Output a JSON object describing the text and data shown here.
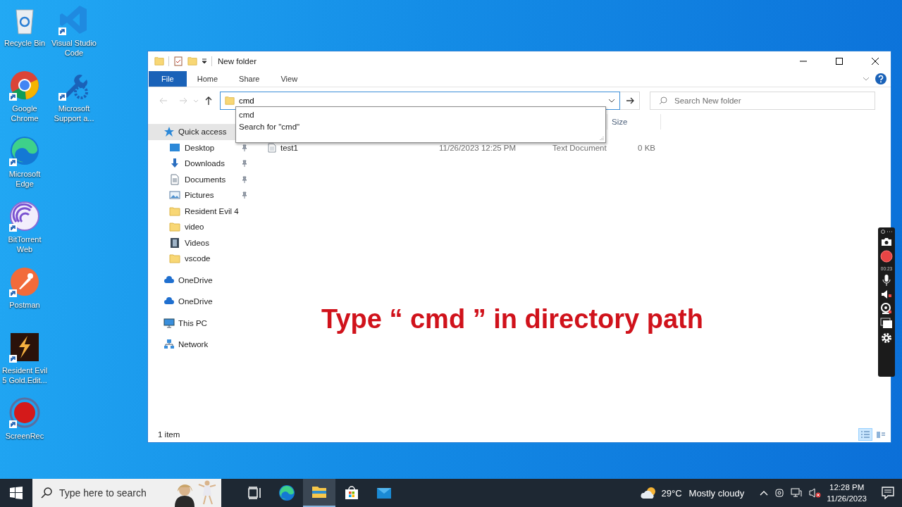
{
  "desktop_icon_columns": [
    [
      {
        "label": "Recycle Bin",
        "kind": "recycle",
        "shortcut": false
      },
      {
        "label": "Google Chrome",
        "kind": "chrome",
        "shortcut": true
      },
      {
        "label": "Microsoft Edge",
        "kind": "edge",
        "shortcut": true
      },
      {
        "label": "BitTorrent Web",
        "kind": "torrent",
        "shortcut": true
      },
      {
        "label": "Postman",
        "kind": "postman",
        "shortcut": true
      },
      {
        "label": "Resident Evil 5 Gold.Edit...",
        "kind": "game",
        "shortcut": true
      },
      {
        "label": "ScreenRec",
        "kind": "rec",
        "shortcut": true
      }
    ],
    [
      {
        "label": "Visual Studio Code",
        "kind": "vscode",
        "shortcut": true
      },
      {
        "label": "Microsoft Support a...",
        "kind": "support",
        "shortcut": true
      }
    ]
  ],
  "window": {
    "title": "New folder",
    "ribbon_tabs": [
      {
        "label": "File",
        "kind": "file"
      },
      {
        "label": "Home",
        "kind": "tab"
      },
      {
        "label": "Share",
        "kind": "tab"
      },
      {
        "label": "View",
        "kind": "tab"
      }
    ],
    "address": {
      "value": "cmd"
    },
    "suggestions": [
      "cmd",
      "Search for \"cmd\""
    ],
    "search": {
      "placeholder": "Search New folder"
    },
    "navigation": [
      {
        "label": "Quick access",
        "kind": "star",
        "selected": true,
        "children": [
          {
            "label": "Desktop",
            "kind": "desktop",
            "pinned": true
          },
          {
            "label": "Downloads",
            "kind": "download",
            "pinned": true
          },
          {
            "label": "Documents",
            "kind": "documents",
            "pinned": true
          },
          {
            "label": "Pictures",
            "kind": "pictures",
            "pinned": true
          },
          {
            "label": "Resident Evil 4",
            "kind": "folder",
            "pinned": false
          },
          {
            "label": "video",
            "kind": "folder",
            "pinned": false
          },
          {
            "label": "Videos",
            "kind": "videos",
            "pinned": false
          },
          {
            "label": "vscode",
            "kind": "folder",
            "pinned": false
          }
        ]
      },
      {
        "label": "OneDrive",
        "kind": "cloud",
        "selected": false
      },
      {
        "label": "OneDrive",
        "kind": "cloud",
        "selected": false
      },
      {
        "label": "This PC",
        "kind": "pc",
        "selected": false
      },
      {
        "label": "Network",
        "kind": "network",
        "selected": false
      }
    ],
    "column_headers": [
      "Size"
    ],
    "files": [
      {
        "name": "test1",
        "date_modified": "11/26/2023 12:25 PM",
        "type": "Text Document",
        "size": "0 KB"
      }
    ],
    "status_bar": "1 item",
    "view_modes": [
      {
        "kind": "details",
        "selected": true
      },
      {
        "kind": "tiles",
        "selected": false
      }
    ]
  },
  "caption": "Type “ cmd ” in directory path",
  "recorder": {
    "timer": "00:23"
  },
  "taskbar": {
    "search_placeholder": "Type here to search",
    "apps": [
      {
        "kind": "taskview",
        "active": false
      },
      {
        "kind": "edge",
        "active": false
      },
      {
        "kind": "explorer",
        "active": true
      },
      {
        "kind": "store",
        "active": false
      },
      {
        "kind": "mail",
        "active": false
      }
    ],
    "weather": {
      "temperature": "29°C",
      "condition": "Mostly cloudy"
    },
    "time": "12:28 PM",
    "date": "11/26/2023"
  }
}
